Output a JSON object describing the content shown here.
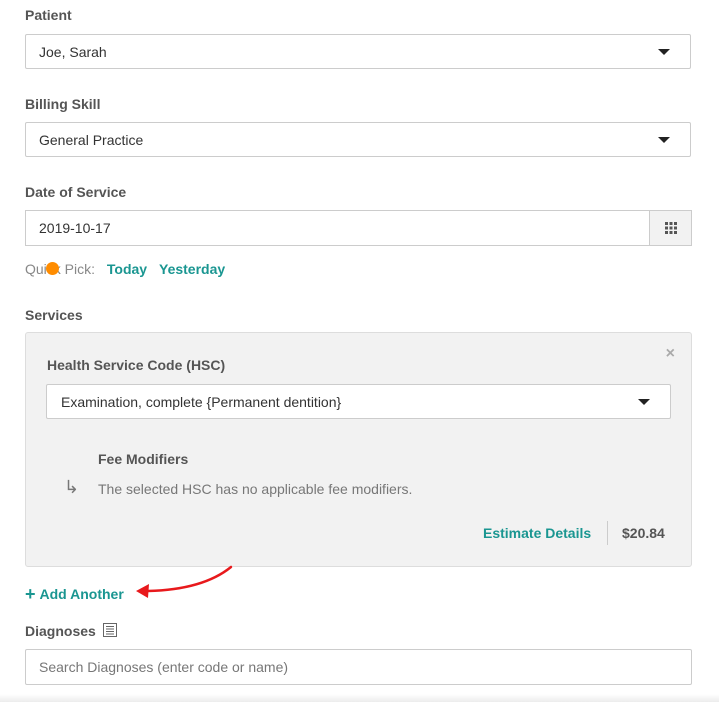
{
  "patient": {
    "label": "Patient",
    "value": "Joe, Sarah"
  },
  "billing_skill": {
    "label": "Billing Skill",
    "value": "General Practice"
  },
  "date_of_service": {
    "label": "Date of Service",
    "value": "2019-10-17",
    "calendar_icon": "calendar-grid-icon"
  },
  "quick_pick": {
    "label": "Quick Pick:",
    "today": "Today",
    "yesterday": "Yesterday"
  },
  "services": {
    "label": "Services",
    "hsc_label": "Health Service Code (HSC)",
    "hsc_value": "Examination, complete {Permanent dentition}",
    "close_icon": "×",
    "fee_modifiers_title": "Fee Modifiers",
    "fee_modifiers_text": "The selected HSC has no applicable fee modifiers.",
    "estimate_label": "Estimate Details",
    "price": "$20.84"
  },
  "add_another": {
    "label": "Add Another",
    "icon": "+"
  },
  "diagnoses": {
    "label": "Diagnoses",
    "placeholder": "Search Diagnoses (enter code or name)"
  },
  "colors": {
    "accent": "#1a9691",
    "annotation": "#e8191c",
    "marker": "#ff8c00"
  }
}
